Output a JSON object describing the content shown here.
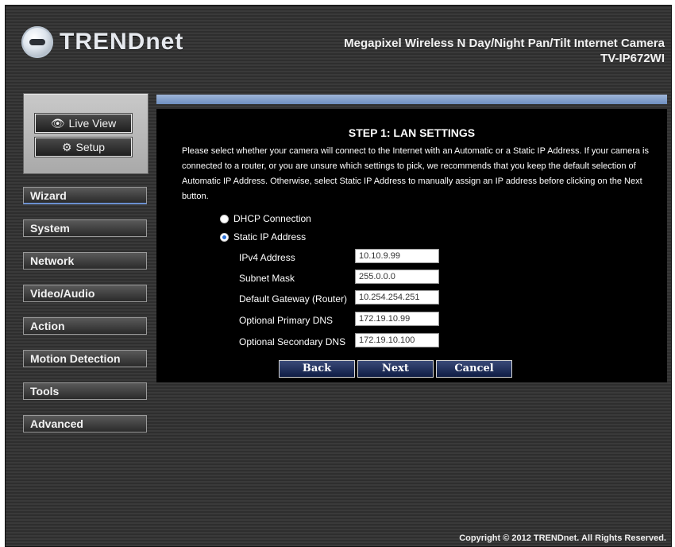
{
  "header": {
    "brand": "TRENDnet",
    "product_line": "Megapixel Wireless N Day/Night Pan/Tilt Internet Camera",
    "model": "TV-IP672WI"
  },
  "top_buttons": {
    "live_view": "Live View",
    "setup": "Setup"
  },
  "menu": [
    {
      "label": "Wizard",
      "active": true
    },
    {
      "label": "System"
    },
    {
      "label": "Network"
    },
    {
      "label": "Video/Audio"
    },
    {
      "label": "Action"
    },
    {
      "label": "Motion Detection"
    },
    {
      "label": "Tools"
    },
    {
      "label": "Advanced"
    }
  ],
  "wizard": {
    "title": "STEP 1: LAN SETTINGS",
    "instructions": "Please select whether your camera will connect to the Internet with an Automatic or a Static IP Address. If your camera is connected to a router, or you are unsure which settings to pick, we recommends that you keep the default selection of Automatic IP Address. Otherwise, select Static IP Address to manually assign an IP address before clicking on the Next button.",
    "options": {
      "dhcp": "DHCP Connection",
      "static": "Static IP Address",
      "selected": "static"
    },
    "fields": {
      "ipv4": {
        "label": "IPv4 Address",
        "value": "10.10.9.99"
      },
      "subnet": {
        "label": "Subnet Mask",
        "value": "255.0.0.0"
      },
      "gateway": {
        "label": "Default Gateway (Router)",
        "value": "10.254.254.251"
      },
      "dns1": {
        "label": "Optional Primary DNS",
        "value": "172.19.10.99"
      },
      "dns2": {
        "label": "Optional Secondary DNS",
        "value": "172.19.10.100"
      }
    },
    "buttons": {
      "back": "Back",
      "next": "Next",
      "cancel": "Cancel"
    }
  },
  "footer": {
    "copyright": "Copyright © 2012 TRENDnet. All Rights Reserved."
  },
  "colors": {
    "accent_blue": "#6f8fc0",
    "button_navy": "#0e1c44",
    "background": "#333333"
  }
}
